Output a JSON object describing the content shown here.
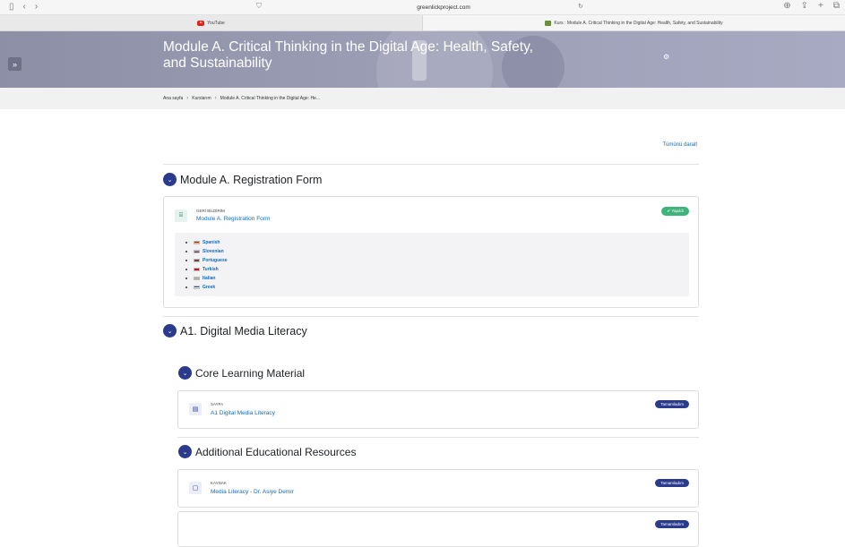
{
  "browser": {
    "url": "greenlickproject.com",
    "tabs": [
      {
        "label": "YouTube",
        "active": false
      },
      {
        "label": "Kurs : Module A. Critical Thinking in the Digital Age: Health, Safety, and Sustainability",
        "active": true
      }
    ]
  },
  "header": {
    "title": "Module A. Critical Thinking in the Digital Age: Health, Safety, and Sustainability",
    "drawer_label": "»"
  },
  "breadcrumb": [
    "Ana sayfa",
    "Kurslarım",
    "Module A. Critical Thinking in the Digital Age: He..."
  ],
  "collapse_all": "Tümünü daralt",
  "sections": {
    "registration": {
      "title": "Module A. Registration Form",
      "activity": {
        "type": "GERİ BİLDİRİM",
        "name": "Module A. Registration Form",
        "status": "✔ Yapıldı"
      },
      "languages": [
        {
          "name": "Spanish",
          "flag_colors": [
            "#c60b1e",
            "#ffc400"
          ]
        },
        {
          "name": "Slovenian",
          "flag_colors": [
            "#ffffff",
            "#1b3c8a",
            "#e4202c"
          ]
        },
        {
          "name": "Portuguese",
          "flag_colors": [
            "#0a6b3a",
            "#e4202c"
          ]
        },
        {
          "name": "Turkish",
          "flag_colors": [
            "#e30a17",
            "#e30a17"
          ]
        },
        {
          "name": "Italian",
          "flag_colors": [
            "#009246",
            "#ffffff",
            "#ce2b37"
          ]
        },
        {
          "name": "Greek",
          "flag_colors": [
            "#0d5eaf",
            "#ffffff"
          ]
        }
      ]
    },
    "a1": {
      "title": "A1. Digital Media Literacy",
      "core": {
        "title": "Core Learning Material",
        "activity": {
          "type": "SAYFA",
          "name": "A1 Digital Media Literacy",
          "status": "Tamamladım"
        }
      },
      "additional": {
        "title": "Additional Educational Resources",
        "activities": [
          {
            "type": "KAYNAK",
            "name": "Media Literacy - Dr. Asiye Demir",
            "status": "Tamamladım"
          },
          {
            "type": "",
            "name": "",
            "status": "Tamamladım"
          }
        ]
      }
    }
  },
  "colors": {
    "primary": "#2a3a8c",
    "link": "#0f6cbf",
    "done": "#3eb37a"
  }
}
